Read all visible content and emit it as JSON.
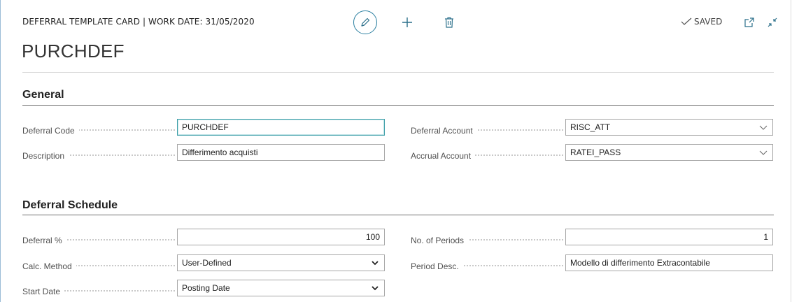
{
  "header": {
    "title": "DEFERRAL TEMPLATE CARD | WORK DATE: 31/05/2020",
    "record_name": "PURCHDEF",
    "status": "SAVED"
  },
  "sections": {
    "general": {
      "title": "General",
      "deferral_code": {
        "label": "Deferral Code",
        "value": "PURCHDEF"
      },
      "description": {
        "label": "Description",
        "value": "Differimento acquisti"
      },
      "deferral_account": {
        "label": "Deferral Account",
        "value": "RISC_ATT"
      },
      "accrual_account": {
        "label": "Accrual Account",
        "value": "RATEI_PASS"
      }
    },
    "schedule": {
      "title": "Deferral Schedule",
      "deferral_pct": {
        "label": "Deferral %",
        "value": "100"
      },
      "calc_method": {
        "label": "Calc. Method",
        "value": "User-Defined"
      },
      "start_date": {
        "label": "Start Date",
        "value": "Posting Date"
      },
      "no_of_periods": {
        "label": "No. of Periods",
        "value": "1"
      },
      "period_desc": {
        "label": "Period Desc.",
        "value": "Modello di differimento Extracontabile"
      }
    }
  },
  "colors": {
    "accent": "#2a7fa0",
    "focus_border": "#3d9ea8",
    "field_border": "#a6a6a6",
    "section_rule": "#6f6f6f"
  },
  "icons": [
    "edit-icon",
    "plus-icon",
    "delete-icon",
    "check-icon",
    "open-new-window-icon",
    "collapse-icon",
    "chevron-down-icon"
  ]
}
